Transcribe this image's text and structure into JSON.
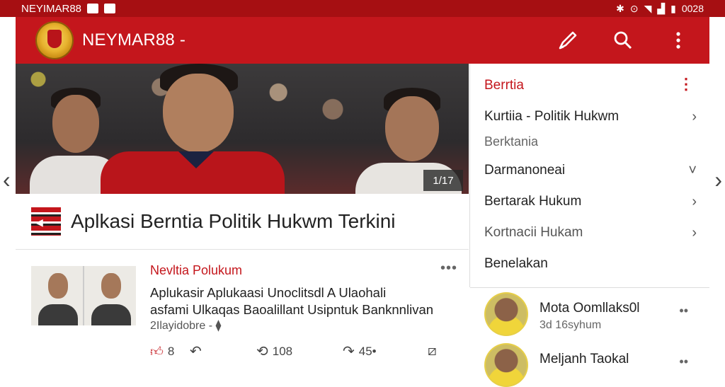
{
  "status": {
    "left_text": "NEYIMAR88",
    "time": "0028"
  },
  "app": {
    "title": "NEYMAR88 -",
    "brand_color": "#c4161c"
  },
  "hero": {
    "counter": "1/17"
  },
  "headline": "Aplkasi Berntia Politik Hukwm Terkini",
  "post": {
    "category": "Nevltia Polukum",
    "text_line1": "Aplukasir  Aplukaasi Unoclitsdl A Ulaohali",
    "text_line2": "asfami Ulkaqas Baoalillant Usipntuk Banknnlivan",
    "meta": "2Ilayidobre -",
    "likes": "8",
    "reposts": "108",
    "shares": "45•"
  },
  "panel": {
    "title": "Berrtia",
    "items": [
      {
        "label": "Kurtiia - Politik Hukwm",
        "chevron": "›"
      },
      {
        "label": "Berktania",
        "chevron": ""
      },
      {
        "label": "Darmanoneai",
        "chevron": "˅"
      },
      {
        "label": "Bertarak Hukum",
        "chevron": "›"
      },
      {
        "label": "Kortnacii Hukam",
        "chevron": "›"
      },
      {
        "label": "Benelakan",
        "chevron": ""
      }
    ]
  },
  "contacts": [
    {
      "name": "Mota Oomllaks0l",
      "sub": "3d 16syhum",
      "more": "••"
    },
    {
      "name": "Meljanh Taokal",
      "sub": "",
      "more": "••"
    }
  ]
}
